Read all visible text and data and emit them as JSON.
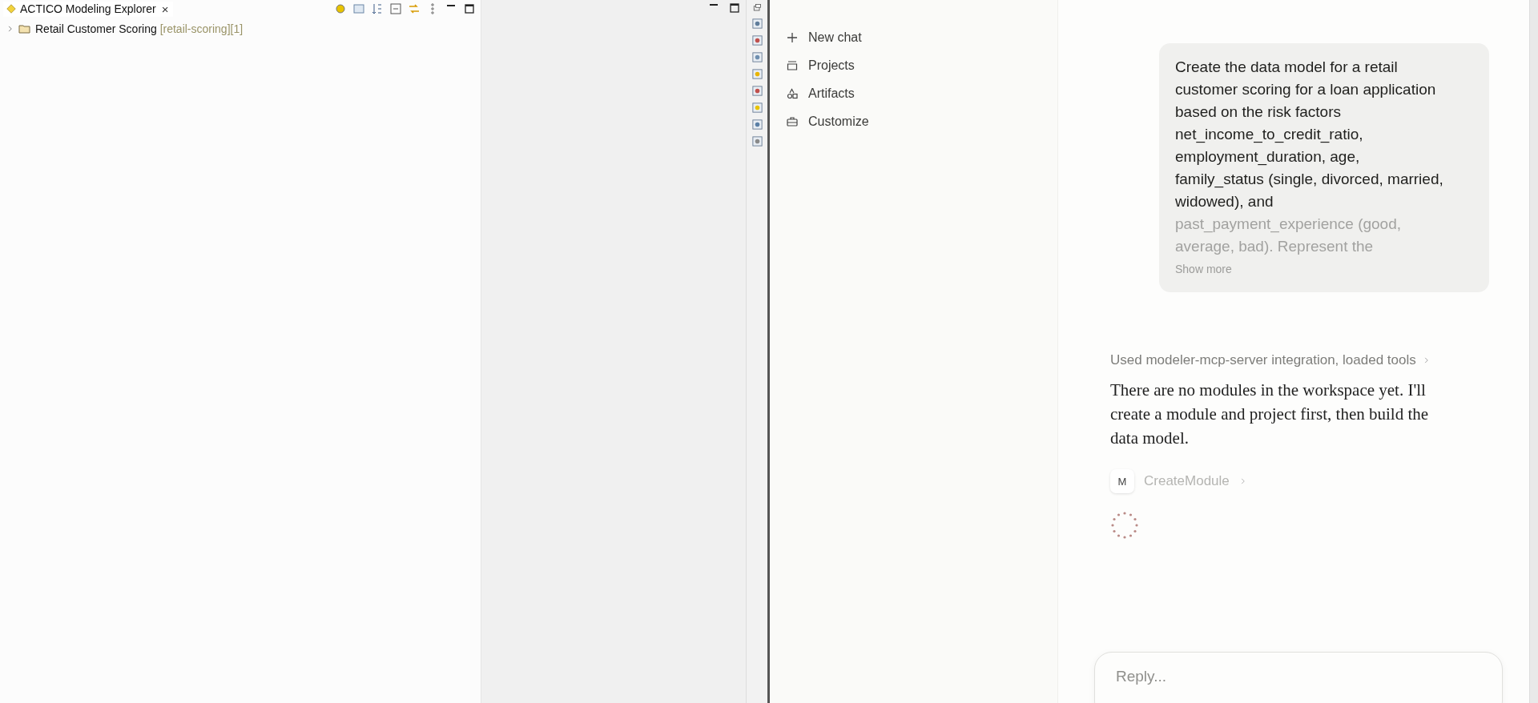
{
  "explorer": {
    "tab": {
      "title": "ACTICO Modeling Explorer",
      "close": "×"
    },
    "tree": [
      {
        "label": "Retail Customer Scoring",
        "detail": "[retail-scoring][1]",
        "expanded": false
      }
    ]
  },
  "chat_sidebar": {
    "items": [
      {
        "kind": "plus",
        "label": "New chat"
      },
      {
        "kind": "projects",
        "label": "Projects"
      },
      {
        "kind": "artifacts",
        "label": "Artifacts"
      },
      {
        "kind": "customize",
        "label": "Customize"
      }
    ]
  },
  "conversation": {
    "user_message": {
      "visible_text": "Create the data model for a retail customer scoring for a loan application based on the risk factors net_income_to_credit_ratio, employment_duration, age, family_status (single, divorced, married, widowed), and",
      "faded_text": "past_payment_experience (good, average, bad). Represent the",
      "show_more": "Show more"
    },
    "tool_summary": "Used modeler-mcp-server integration, loaded tools",
    "assistant_text": "There are no modules in the workspace yet. I'll create a module and project first, then build the data model.",
    "tool_call": {
      "badge": "M",
      "name": "CreateModule"
    },
    "reply": {
      "placeholder": "Reply..."
    }
  }
}
